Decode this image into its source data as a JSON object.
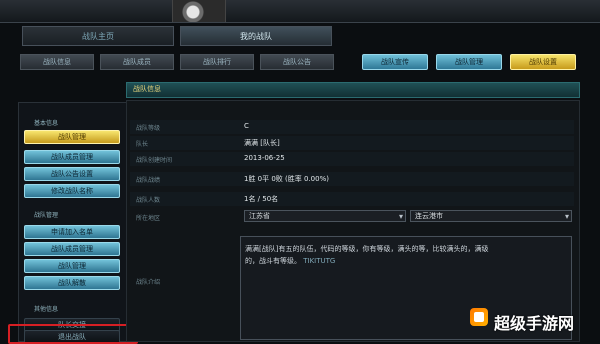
{
  "main_tabs": [
    {
      "label": "战队主页"
    },
    {
      "label": "我的战队"
    }
  ],
  "sub_tabs": [
    {
      "label": "战队信息"
    },
    {
      "label": "战队成员"
    },
    {
      "label": "战队排行"
    },
    {
      "label": "战队公告"
    }
  ],
  "actions": [
    {
      "label": "战队宣传"
    },
    {
      "label": "战队管理"
    },
    {
      "label": "战队设置"
    }
  ],
  "panel_title": "战队信息",
  "sidebar": {
    "sections": [
      {
        "title": "基本信息",
        "items": [
          {
            "label": "战队管理",
            "style": "yellow"
          },
          {
            "label": "战队成员管理",
            "style": "blue"
          },
          {
            "label": "战队公告设置",
            "style": "blue"
          },
          {
            "label": "修改战队名称",
            "style": "blue"
          }
        ]
      },
      {
        "title": "战队管理",
        "items": [
          {
            "label": "申请加入名单",
            "style": "blue"
          },
          {
            "label": "战队成员管理",
            "style": "blue"
          },
          {
            "label": "战队管理",
            "style": "blue"
          },
          {
            "label": "战队解散",
            "style": "blue"
          }
        ]
      },
      {
        "title": "其他信息",
        "items": [
          {
            "label": "队长交接",
            "style": "dark"
          },
          {
            "label": "退出战队",
            "style": "dark"
          }
        ]
      }
    ]
  },
  "fields": [
    {
      "label": "战队等级",
      "value": "C"
    },
    {
      "label": "队长",
      "value": "满满 [队长]"
    },
    {
      "label": "战队创建时间",
      "value": "2013-06-25"
    },
    {
      "label": "战队战绩",
      "value": "1胜 0平 0败 (胜率 0.00%)"
    },
    {
      "label": "战队人数",
      "value": "1名 / 50名"
    }
  ],
  "region": {
    "label": "所在地区",
    "province": "江苏省",
    "city": "连云港市"
  },
  "intro": {
    "label": "战队介绍",
    "text_line1": "满满[战队]有五的队伍，代码的等级，你有等级，满头的等，比较满头的，满级",
    "text_line2": "的，战斗有等级。",
    "tag": "TIKITUTG"
  },
  "watermark": {
    "text": "超级手游网",
    "icon": "logo-icon"
  }
}
